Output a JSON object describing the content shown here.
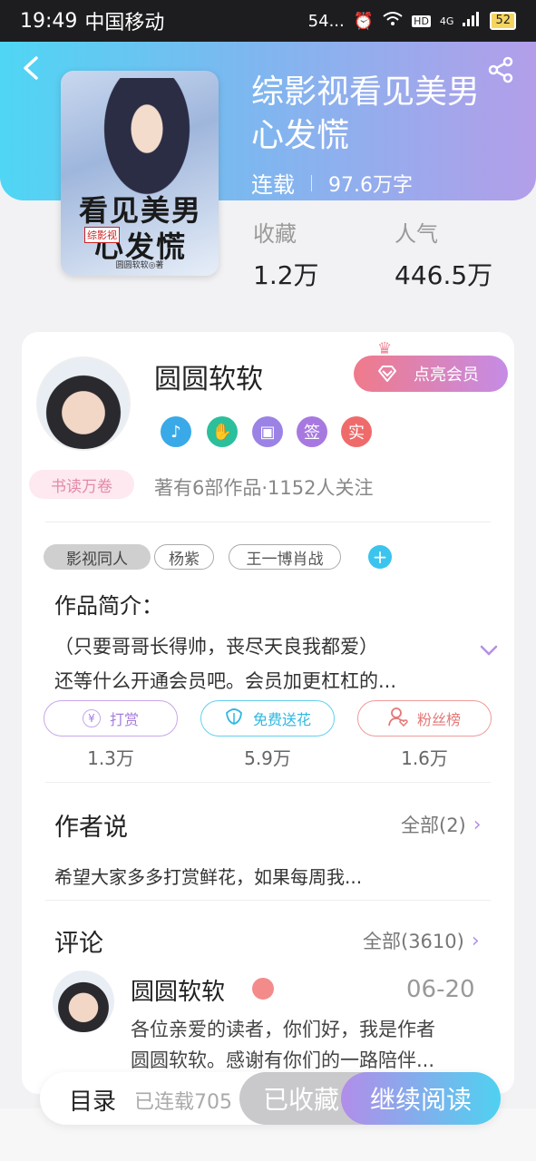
{
  "status_bar": {
    "time": "19:49",
    "carrier": "中国移动",
    "speed": "54...",
    "network": "4G",
    "hd": "HD",
    "battery": "52"
  },
  "book": {
    "title": "综影视看见美男心发慌",
    "status": "连载",
    "word_count": "97.6万字",
    "cover_title": "看见美男心发慌",
    "cover_seal": "综影视",
    "cover_author": "圆圆软软◎著"
  },
  "stats": {
    "favorites_label": "收藏",
    "favorites_value": "1.2万",
    "popularity_label": "人气",
    "popularity_value": "446.5万"
  },
  "author": {
    "name": "圆圆软软",
    "vip_label": "点亮会员",
    "badges": [
      "music-badge",
      "handshake-badge",
      "calendar-badge",
      "签",
      "实"
    ],
    "reading_badge": "书读万卷",
    "summary": "著有6部作品·1152人关注"
  },
  "tags": [
    "影视同人",
    "杨紫",
    "王一博肖战"
  ],
  "intro": {
    "heading": "作品简介：",
    "text_line1": "（只要哥哥长得帅，丧尽天良我都爱）",
    "text_line2": "还等什么开通会员吧。会员加更杠杠的..."
  },
  "actions": {
    "reward_label": "打赏",
    "reward_count": "1.3万",
    "flower_label": "免费送花",
    "flower_count": "5.9万",
    "fans_label": "粉丝榜",
    "fans_count": "1.6万"
  },
  "author_says": {
    "heading": "作者说",
    "see_all": "全部(2)",
    "text": "希望大家多多打赏鲜花，如果每周我..."
  },
  "comments": {
    "heading": "评论",
    "see_all": "全部(3610)",
    "items": [
      {
        "name": "圆圆软软",
        "date": "06-20",
        "text_line1": "各位亲爱的读者，你们好，我是作者",
        "text_line2": "圆圆软软。感谢有你们的一路陪伴..."
      }
    ]
  },
  "bottom_bar": {
    "toc_label": "目录",
    "toc_progress": "已连载705",
    "collect_label": "已收藏",
    "read_label": "继续阅读"
  },
  "colors": {
    "header_start": "#4fd6f4",
    "header_end": "#b39ee9",
    "accent_purple": "#b490e6",
    "accent_cyan": "#3ac4ee",
    "accent_pink": "#f07a8a"
  }
}
